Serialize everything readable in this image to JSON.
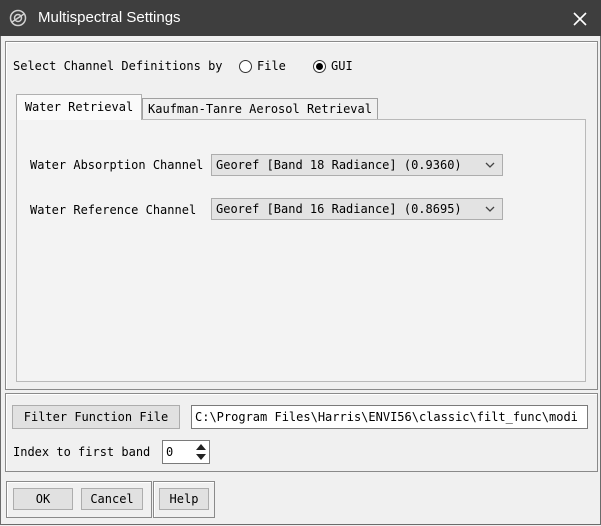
{
  "window": {
    "title": "Multispectral Settings"
  },
  "channel_source": {
    "label": "Select Channel Definitions by",
    "options": [
      {
        "label": "File",
        "selected": false
      },
      {
        "label": "GUI",
        "selected": true
      }
    ]
  },
  "tabs": [
    {
      "label": "Water Retrieval",
      "active": true
    },
    {
      "label": "Kaufman-Tanre Aerosol Retrieval",
      "active": false
    }
  ],
  "water_retrieval": {
    "absorption": {
      "label": "Water Absorption Channel",
      "value": "Georef [Band 18 Radiance] (0.9360)"
    },
    "reference": {
      "label": "Water Reference Channel",
      "value": "Georef [Band 16 Radiance] (0.8695)"
    }
  },
  "filter_function": {
    "button_label": "Filter Function File",
    "path": "C:\\Program Files\\Harris\\ENVI56\\classic\\filt_func\\modi"
  },
  "first_band": {
    "label": "Index to first band",
    "value": "0"
  },
  "buttons": {
    "ok": "OK",
    "cancel": "Cancel",
    "help": "Help"
  },
  "icons": {
    "app": "envi-app-icon",
    "close": "close-icon",
    "chevron": "chevron-down-icon",
    "spinner": "spinner-arrows-icon"
  }
}
